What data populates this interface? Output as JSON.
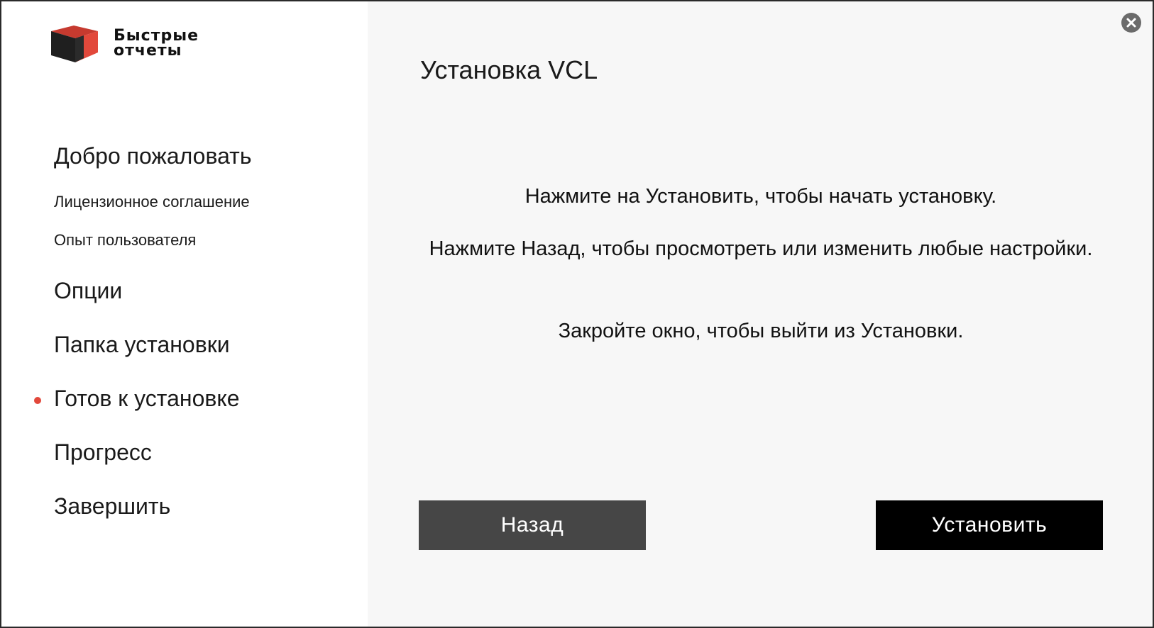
{
  "brand": {
    "line1": "Быстрые",
    "line2": "отчеты",
    "accent_color": "#e2483b",
    "dark_color": "#1a1a1a"
  },
  "title": "Установка VCL",
  "sidebar": {
    "items": [
      {
        "label": "Добро пожаловать",
        "active": false
      },
      {
        "label": "Лицензионное соглашение",
        "active": false
      },
      {
        "label": "Опыт пользователя",
        "active": false
      },
      {
        "label": "Опции",
        "active": false
      },
      {
        "label": "Папка установки",
        "active": false
      },
      {
        "label": "Готов к установке",
        "active": true
      },
      {
        "label": "Прогресс",
        "active": false
      },
      {
        "label": "Завершить",
        "active": false
      }
    ]
  },
  "content": {
    "line1": "Нажмите на Установить, чтобы начать установку.",
    "line2": "Нажмите Назад, чтобы просмотреть или изменить любые настройки.",
    "line3": "Закройте окно, чтобы выйти из Установки."
  },
  "buttons": {
    "back": "Назад",
    "install": "Установить"
  },
  "icons": {
    "close": "close-icon",
    "logo": "brand-cube-icon"
  }
}
